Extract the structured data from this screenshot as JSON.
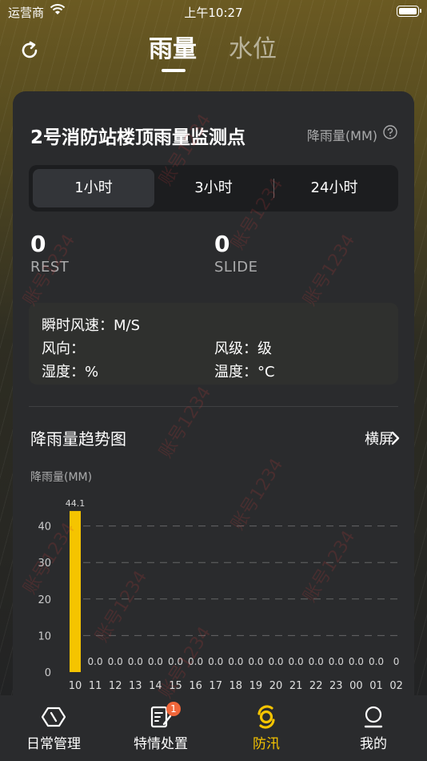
{
  "status_bar": {
    "carrier": "运营商",
    "time": "上午10:27"
  },
  "header": {
    "tabs": [
      {
        "label": "雨量"
      },
      {
        "label": "水位"
      }
    ]
  },
  "station": {
    "title": "2号消防站楼顶雨量监测点",
    "unit_label": "降雨量(MM)",
    "segments": [
      "1小时",
      "3小时",
      "24小时"
    ],
    "stats": [
      {
        "value": "0",
        "label": "REST"
      },
      {
        "value": "0",
        "label": "SLIDE"
      }
    ],
    "weather": {
      "wind_speed": "瞬时风速：M/S",
      "wind_direction": "风向：",
      "wind_level": "风级：级",
      "humidity": "湿度：%",
      "temperature": "温度：°C"
    }
  },
  "trend": {
    "title": "降雨量趋势图",
    "landscape_label": "横屏",
    "y_unit": "降雨量(MM)"
  },
  "chart_data": {
    "type": "bar",
    "categories": [
      "10",
      "11",
      "12",
      "13",
      "14",
      "15",
      "16",
      "17",
      "18",
      "19",
      "20",
      "21",
      "22",
      "23",
      "00",
      "01",
      "02"
    ],
    "values": [
      44.1,
      0,
      0,
      0,
      0,
      0,
      0,
      0,
      0,
      0,
      0,
      0,
      0,
      0,
      0,
      0,
      0
    ],
    "data_labels": [
      "44.1",
      "0.0",
      "0.0",
      "0.0",
      "0.0",
      "0.0",
      "0.0",
      "0.0",
      "0.0",
      "0.0",
      "0.0",
      "0.0",
      "0.0",
      "0.0",
      "0.0",
      "0.0",
      "0"
    ],
    "y_ticks": [
      "0",
      "10",
      "20",
      "30",
      "40"
    ],
    "ylim": [
      0,
      45
    ],
    "ylabel": "降雨量(MM)",
    "xlabel": "",
    "title": "",
    "grid": true,
    "bar_color": "#f5c400"
  },
  "bottom_nav": [
    {
      "label": "日常管理",
      "icon": "hexagon-icon"
    },
    {
      "label": "特情处置",
      "icon": "document-edit-icon",
      "badge": "1"
    },
    {
      "label": "防汛",
      "icon": "typhoon-icon"
    },
    {
      "label": "我的",
      "icon": "user-icon"
    }
  ],
  "watermark": "账号1234",
  "colors": {
    "accent": "#f5c400",
    "card": "#2a2b2d",
    "badge": "#f0663a"
  }
}
